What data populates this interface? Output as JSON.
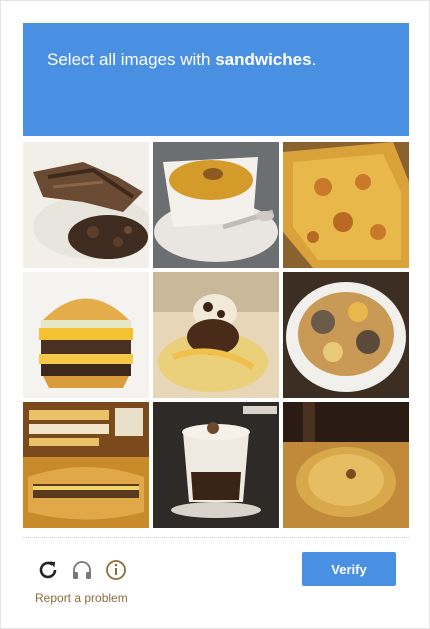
{
  "prompt": {
    "prefix": "Select all images with ",
    "target": "sandwiches",
    "suffix": "."
  },
  "tiles": [
    {
      "subject": "shredded-meat"
    },
    {
      "subject": "soup-bowl"
    },
    {
      "subject": "pizza"
    },
    {
      "subject": "burger"
    },
    {
      "subject": "ice-cream-dessert"
    },
    {
      "subject": "food-plate"
    },
    {
      "subject": "sub-sandwich-sign"
    },
    {
      "subject": "coffee-drink"
    },
    {
      "subject": "plate-on-table"
    }
  ],
  "toolbar": {
    "reload_icon": "reload-icon",
    "audio_icon": "headphones-icon",
    "info_icon": "info-icon",
    "report_label": "Report a problem",
    "verify_label": "Verify"
  },
  "colors": {
    "accent": "#4a90e2",
    "report_text": "#8a6d3b"
  }
}
